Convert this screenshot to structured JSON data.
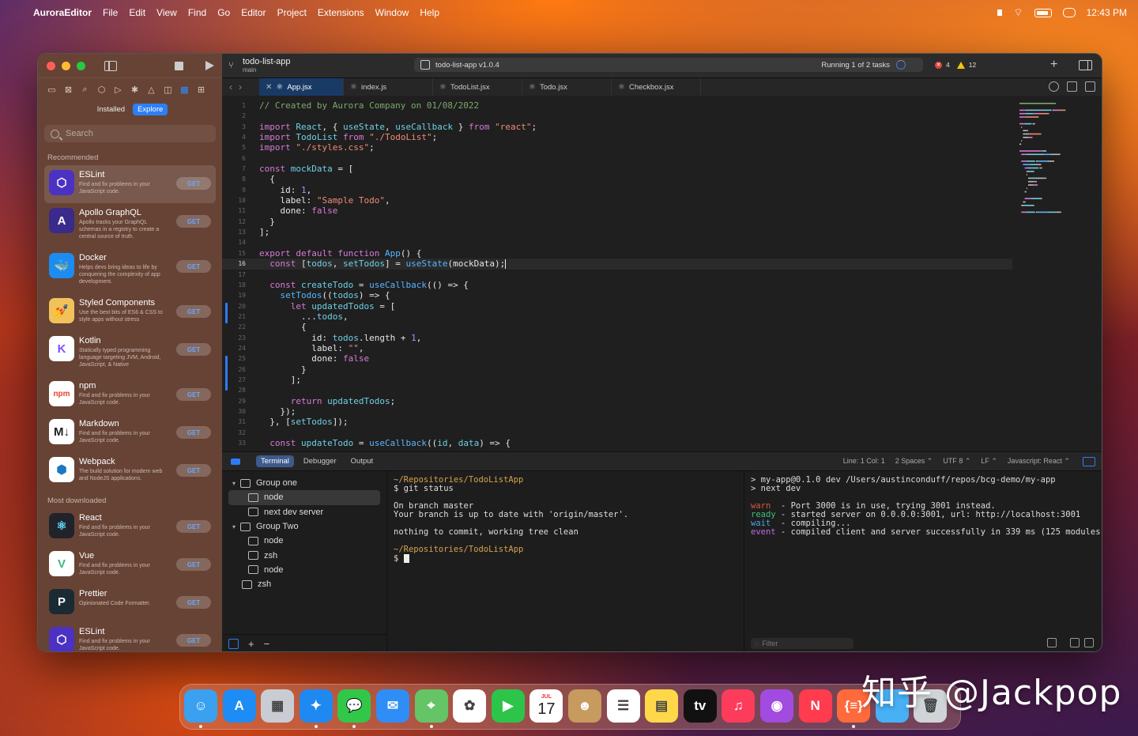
{
  "menubar": {
    "app_name": "AuroraEditor",
    "items": [
      "File",
      "Edit",
      "View",
      "Find",
      "Go",
      "Editor",
      "Project",
      "Extensions",
      "Window",
      "Help"
    ],
    "time": "12:43 PM"
  },
  "sidebar": {
    "segment": {
      "installed": "Installed",
      "explore": "Explore",
      "selected": "Explore"
    },
    "search_placeholder": "Search",
    "recommended_title": "Recommended",
    "most_downloaded_title": "Most downloaded",
    "get_label": "GET",
    "recommended": [
      {
        "name": "ESLint",
        "desc": "Find and fix problems in your JavaScript code.",
        "color": "#4b32c3",
        "icon": "eslint-icon",
        "glyph": "⬡"
      },
      {
        "name": "Apollo GraphQL",
        "desc": "Apollo tracks your GraphQL schemas in a registry to create a central source of truth.",
        "color": "#3a2a8a",
        "icon": "apollo-icon",
        "glyph": "A"
      },
      {
        "name": "Docker",
        "desc": "Helps devs bring ideas to life by conquering the complexity of app development.",
        "color": "#1d8cf0",
        "icon": "docker-icon",
        "glyph": "🐳"
      },
      {
        "name": "Styled Components",
        "desc": "Use the best bits of ES6 & CSS to style apps without stress",
        "color": "#f2c25a",
        "icon": "styled-components-icon",
        "glyph": "💅"
      },
      {
        "name": "Kotlin",
        "desc": "Statically typed programming language targeting JVM, Android, JavaScript, & Native",
        "color": "#ffffff",
        "icon": "kotlin-icon",
        "glyph": "K"
      },
      {
        "name": "npm",
        "desc": "Find and fix problems in your JavaScript code.",
        "color": "#ffffff",
        "icon": "npm-icon",
        "glyph": "npm"
      },
      {
        "name": "Markdown",
        "desc": "Find and fix problems in your JavaScript code.",
        "color": "#ffffff",
        "icon": "markdown-icon",
        "glyph": "M↓"
      },
      {
        "name": "Webpack",
        "desc": "The build solution for modern web and NodeJS applications.",
        "color": "#ffffff",
        "icon": "webpack-icon",
        "glyph": "⬢"
      }
    ],
    "most_downloaded": [
      {
        "name": "React",
        "desc": "Find and fix problems in your JavaScript code.",
        "color": "#20232a",
        "icon": "react-icon",
        "glyph": "⚛"
      },
      {
        "name": "Vue",
        "desc": "Find and fix problems in your JavaScript code.",
        "color": "#ffffff",
        "icon": "vue-icon",
        "glyph": "V"
      },
      {
        "name": "Prettier",
        "desc": "Opinionated Code Formatter.",
        "color": "#1a2b34",
        "icon": "prettier-icon",
        "glyph": "P"
      },
      {
        "name": "ESLint",
        "desc": "Find and fix problems in your JavaScript code.",
        "color": "#4b32c3",
        "icon": "eslint-icon",
        "glyph": "⬡"
      }
    ]
  },
  "toolbar": {
    "project": "todo-list-app",
    "branch": "main",
    "scheme": "todo-list-app v1.0.4",
    "running": "Running 1 of 2 tasks",
    "errors": "4",
    "warnings": "12"
  },
  "tabs": [
    {
      "label": "App.jsx",
      "active": true
    },
    {
      "label": "index.js"
    },
    {
      "label": "TodoList.jsx"
    },
    {
      "label": "Todo.jsx"
    },
    {
      "label": "Checkbox.jsx"
    }
  ],
  "editor": {
    "current_line": 16,
    "lines": [
      [
        [
          "cm",
          "// Created by Aurora Company on 01/08/2022"
        ]
      ],
      [],
      [
        [
          "kw",
          "import "
        ],
        [
          "vr",
          "React"
        ],
        [
          "tx",
          ", { "
        ],
        [
          "vr",
          "useState"
        ],
        [
          "tx",
          ", "
        ],
        [
          "vr",
          "useCallback"
        ],
        [
          "tx",
          " } "
        ],
        [
          "kw",
          "from "
        ],
        [
          "st",
          "\"react\""
        ],
        [
          "tx",
          ";"
        ]
      ],
      [
        [
          "kw",
          "import "
        ],
        [
          "vr",
          "TodoList "
        ],
        [
          "kw",
          "from "
        ],
        [
          "st",
          "\"./TodoList\""
        ],
        [
          "tx",
          ";"
        ]
      ],
      [
        [
          "kw",
          "import "
        ],
        [
          "st",
          "\"./styles.css\""
        ],
        [
          "tx",
          ";"
        ]
      ],
      [],
      [
        [
          "kw",
          "const "
        ],
        [
          "vr",
          "mockData"
        ],
        [
          "tx",
          " = ["
        ]
      ],
      [
        [
          "tx",
          "  {"
        ]
      ],
      [
        [
          "tx",
          "    id: "
        ],
        [
          "nm",
          "1"
        ],
        [
          "tx",
          ","
        ]
      ],
      [
        [
          "tx",
          "    label: "
        ],
        [
          "st",
          "\"Sample Todo\""
        ],
        [
          "tx",
          ","
        ]
      ],
      [
        [
          "tx",
          "    done: "
        ],
        [
          "kw",
          "false"
        ]
      ],
      [
        [
          "tx",
          "  }"
        ]
      ],
      [
        [
          "tx",
          "];"
        ]
      ],
      [],
      [
        [
          "kw",
          "export default function "
        ],
        [
          "fn",
          "App"
        ],
        [
          "tx",
          "() {"
        ]
      ],
      [
        [
          "kw",
          "  const "
        ],
        [
          "tx",
          "["
        ],
        [
          "vr",
          "todos"
        ],
        [
          "tx",
          ", "
        ],
        [
          "vr",
          "setTodos"
        ],
        [
          "tx",
          "] = "
        ],
        [
          "fn",
          "useState"
        ],
        [
          "tx",
          "(mockData);"
        ]
      ],
      [],
      [
        [
          "kw",
          "  const "
        ],
        [
          "vr",
          "createTodo"
        ],
        [
          "tx",
          " = "
        ],
        [
          "fn",
          "useCallback"
        ],
        [
          "tx",
          "(() => {"
        ]
      ],
      [
        [
          "fn",
          "    setTodos"
        ],
        [
          "tx",
          "(("
        ],
        [
          "vr",
          "todos"
        ],
        [
          "tx",
          ") => {"
        ]
      ],
      [
        [
          "kw",
          "      let "
        ],
        [
          "vr",
          "updatedTodos"
        ],
        [
          "tx",
          " = ["
        ]
      ],
      [
        [
          "tx",
          "        ..."
        ],
        [
          "vr",
          "todos"
        ],
        [
          "tx",
          ","
        ]
      ],
      [
        [
          "tx",
          "        {"
        ]
      ],
      [
        [
          "tx",
          "          id: "
        ],
        [
          "vr",
          "todos"
        ],
        [
          "tx",
          ".length + "
        ],
        [
          "nm",
          "1"
        ],
        [
          "tx",
          ","
        ]
      ],
      [
        [
          "tx",
          "          label: "
        ],
        [
          "st",
          "\"\""
        ],
        [
          "tx",
          ","
        ]
      ],
      [
        [
          "tx",
          "          done: "
        ],
        [
          "kw",
          "false"
        ]
      ],
      [
        [
          "tx",
          "        }"
        ]
      ],
      [
        [
          "tx",
          "      ];"
        ]
      ],
      [],
      [
        [
          "kw",
          "      return "
        ],
        [
          "vr",
          "updatedTodos"
        ],
        [
          "tx",
          ";"
        ]
      ],
      [
        [
          "tx",
          "    });"
        ]
      ],
      [
        [
          "tx",
          "  }, ["
        ],
        [
          "vr",
          "setTodos"
        ],
        [
          "tx",
          "]);"
        ]
      ],
      [],
      [
        [
          "kw",
          "  const "
        ],
        [
          "vr",
          "updateTodo"
        ],
        [
          "tx",
          " = "
        ],
        [
          "fn",
          "useCallback"
        ],
        [
          "tx",
          "(("
        ],
        [
          "vr",
          "id"
        ],
        [
          "tx",
          ", "
        ],
        [
          "vr",
          "data"
        ],
        [
          "tx",
          ") => {"
        ]
      ]
    ]
  },
  "bottom": {
    "tabs": [
      "Terminal",
      "Debugger",
      "Output"
    ],
    "status": [
      "Line: 1  Col: 1",
      "2 Spaces ⌃",
      "UTF 8 ⌃",
      "LF ⌃",
      "Javascript: React ⌃"
    ],
    "tree": {
      "group1": "Group one",
      "g1_items": [
        "node",
        "next dev server"
      ],
      "group2": "Group Two",
      "g2_items": [
        "node",
        "zsh",
        "node"
      ],
      "root_item": "zsh"
    },
    "term1": [
      [
        "path",
        "~/Repositories/TodoListApp"
      ],
      [
        "plain",
        "$ git status"
      ],
      [
        "plain",
        ""
      ],
      [
        "plain",
        "On branch master"
      ],
      [
        "plain",
        "Your branch is up to date with 'origin/master'."
      ],
      [
        "plain",
        ""
      ],
      [
        "plain",
        "nothing to commit, working tree clean"
      ],
      [
        "plain",
        ""
      ],
      [
        "path",
        "~/Repositories/TodoListApp"
      ]
    ],
    "term1_prompt": "$ ",
    "term2": [
      [
        "plain",
        "",
        "> my-app@0.1.0 dev /Users/austinconduff/repos/bcg-demo/my-app"
      ],
      [
        "plain",
        "",
        "> next dev"
      ],
      [
        "plain",
        "",
        ""
      ],
      [
        "warnc",
        "warn ",
        " - Port 3000 is in use, trying 3001 instead."
      ],
      [
        "readyc",
        "ready",
        " - started server on 0.0.0.0:3001, url: http://localhost:3001"
      ],
      [
        "waitc",
        "wait ",
        " - compiling..."
      ],
      [
        "eventc",
        "event",
        " - compiled client and server successfully in 339 ms (125 modules)"
      ]
    ],
    "filter_placeholder": "Filter"
  },
  "dock": {
    "apps": [
      {
        "name": "finder-icon",
        "color": "#3aa0f0",
        "glyph": "☺",
        "dot": true
      },
      {
        "name": "app-store-icon",
        "color": "#1e8cf5",
        "glyph": "A",
        "dot": false
      },
      {
        "name": "launchpad-icon",
        "color": "#c9cdd3",
        "glyph": "▦",
        "dot": false
      },
      {
        "name": "safari-icon",
        "color": "#1f89f2",
        "glyph": "✦",
        "dot": true
      },
      {
        "name": "messages-icon",
        "color": "#31c84a",
        "glyph": "💬",
        "dot": true
      },
      {
        "name": "mail-icon",
        "color": "#2f8ef5",
        "glyph": "✉",
        "dot": false
      },
      {
        "name": "maps-icon",
        "color": "#64c466",
        "glyph": "⌖",
        "dot": true
      },
      {
        "name": "photos-icon",
        "color": "#ffffff",
        "glyph": "✿",
        "dot": false
      },
      {
        "name": "facetime-icon",
        "color": "#2cc54a",
        "glyph": "▶",
        "dot": false
      },
      {
        "name": "calendar-icon",
        "color": "#ffffff",
        "glyph": "17",
        "dot": false
      },
      {
        "name": "contacts-icon",
        "color": "#c79a5e",
        "glyph": "☻",
        "dot": false
      },
      {
        "name": "reminders-icon",
        "color": "#ffffff",
        "glyph": "☰",
        "dot": false
      },
      {
        "name": "notes-icon",
        "color": "#ffd84a",
        "glyph": "▤",
        "dot": false
      },
      {
        "name": "apple-tv-icon",
        "color": "#111111",
        "glyph": "tv",
        "dot": false
      },
      {
        "name": "music-icon",
        "color": "#fc3c5a",
        "glyph": "♫",
        "dot": false
      },
      {
        "name": "podcasts-icon",
        "color": "#a24be0",
        "glyph": "◉",
        "dot": false
      },
      {
        "name": "news-icon",
        "color": "#ff3b4e",
        "glyph": "N",
        "dot": false
      },
      {
        "name": "aurora-editor-icon",
        "color": "#ff6a3d",
        "glyph": "{≡}",
        "dot": true
      },
      {
        "name": "folder-icon",
        "color": "#48b0f5",
        "glyph": "",
        "dot": false
      },
      {
        "name": "trash-icon",
        "color": "#cfd4d8",
        "glyph": "🗑",
        "dot": false
      }
    ],
    "calendar_month": "JUL"
  },
  "watermark": "知乎 @Jackpop"
}
